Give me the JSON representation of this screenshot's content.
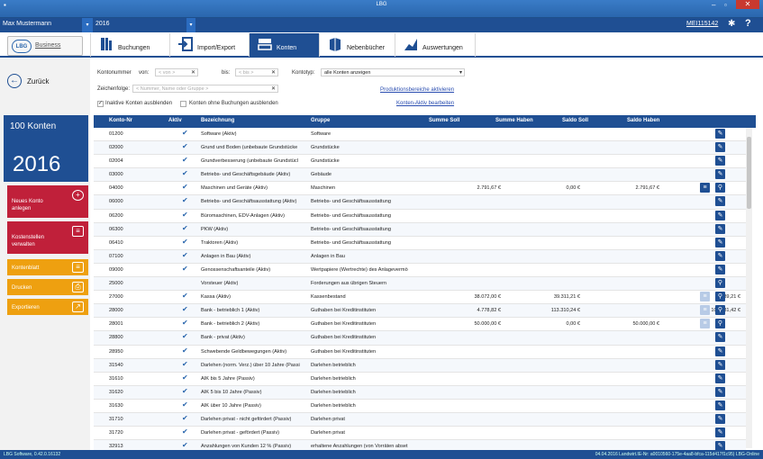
{
  "window": {
    "title": "LBG"
  },
  "userbar": {
    "user": "Max Mustermann",
    "year": "2016",
    "code": "MEI115142"
  },
  "logo": {
    "brand": "LBG",
    "link": "Business"
  },
  "nav": {
    "tabs": [
      {
        "label": "Buchungen",
        "icon": "ledger-icon"
      },
      {
        "label": "Import/Export",
        "icon": "import-export-icon"
      },
      {
        "label": "Konten",
        "icon": "accounts-icon",
        "active": true
      },
      {
        "label": "Nebenbücher",
        "icon": "books-icon"
      },
      {
        "label": "Auswertungen",
        "icon": "chart-icon"
      }
    ]
  },
  "sidebar": {
    "back_label": "Zurück",
    "count_label": "100 Konten",
    "year": "2016",
    "buttons": [
      {
        "label": "Neues Konto anlegen",
        "icon": "plus-icon"
      },
      {
        "label": "Kostenstellen verwalten",
        "icon": "list-icon"
      },
      {
        "label": "Kontenblatt",
        "icon": "list-icon"
      },
      {
        "label": "Drucken",
        "icon": "printer-icon"
      },
      {
        "label": "Exportieren",
        "icon": "export-icon"
      }
    ]
  },
  "filters": {
    "kontonummer_label": "Kontonummer",
    "von_label": "von:",
    "von_placeholder": "< von >",
    "bis_label": "bis:",
    "bis_placeholder": "< bis >",
    "kontotyp_label": "Kontotyp:",
    "kontotyp_value": "alle Konten anzeigen",
    "zeichenfolge_label": "Zeichenfolge:",
    "zeichenfolge_placeholder": "< Nummer, Name oder Gruppe >",
    "produktionsbereiche_link": "Produktionsbereiche aktivieren",
    "inaktive_label": "Inaktive Konten ausblenden",
    "inaktive_checked": true,
    "ohne_buchungen_label": "Konten ohne Buchungen ausblenden",
    "ohne_buchungen_checked": false,
    "konten_aktiv_link": "Konten-Aktiv bearbeiten"
  },
  "table": {
    "headers": [
      "Konto-Nr",
      "Aktiv",
      "Bezeichnung",
      "Gruppe",
      "Summe Soll",
      "Summe Haben",
      "Saldo Soll",
      "Saldo Haben"
    ],
    "rows": [
      {
        "nr": "01200",
        "aktiv": true,
        "bez": "Software (Aktiv)",
        "grp": "Software",
        "ss": "",
        "sh": "",
        "sa": "",
        "sb": "",
        "list": ""
      },
      {
        "nr": "02000",
        "aktiv": true,
        "bez": "Grund und Boden (unbebaute Grundstücke",
        "grp": "Grundstücke",
        "ss": "",
        "sh": "",
        "sa": "",
        "sb": "",
        "list": ""
      },
      {
        "nr": "02004",
        "aktiv": true,
        "bez": "Grundverbesserung (unbebaute Grundstücl",
        "grp": "Grundstücke",
        "ss": "",
        "sh": "",
        "sa": "",
        "sb": "",
        "list": ""
      },
      {
        "nr": "03000",
        "aktiv": true,
        "bez": "Betriebs- und Geschäftsgebäude (Aktiv)",
        "grp": "Gebäude",
        "ss": "",
        "sh": "",
        "sa": "",
        "sb": "",
        "list": ""
      },
      {
        "nr": "04000",
        "aktiv": true,
        "bez": "Maschinen und Geräte (Aktiv)",
        "grp": "Maschinen",
        "ss": "2.791,67 €",
        "sh": "0,00 €",
        "sa": "2.791,67 €",
        "sb": "",
        "list": "solid"
      },
      {
        "nr": "06000",
        "aktiv": true,
        "bez": "Betriebs- und Geschäftsausstattung (Aktiv)",
        "grp": "Betriebs- und Geschäftsausstattung",
        "ss": "",
        "sh": "",
        "sa": "",
        "sb": "",
        "list": ""
      },
      {
        "nr": "06200",
        "aktiv": true,
        "bez": "Büromaschinen, EDV-Anlagen (Aktiv)",
        "grp": "Betriebs- und Geschäftsausstattung",
        "ss": "",
        "sh": "",
        "sa": "",
        "sb": "",
        "list": ""
      },
      {
        "nr": "06300",
        "aktiv": true,
        "bez": "PKW (Aktiv)",
        "grp": "Betriebs- und Geschäftsausstattung",
        "ss": "",
        "sh": "",
        "sa": "",
        "sb": "",
        "list": ""
      },
      {
        "nr": "06410",
        "aktiv": true,
        "bez": "Traktoren (Aktiv)",
        "grp": "Betriebs- und Geschäftsausstattung",
        "ss": "",
        "sh": "",
        "sa": "",
        "sb": "",
        "list": ""
      },
      {
        "nr": "07100",
        "aktiv": true,
        "bez": "Anlagen in Bau (Aktiv)",
        "grp": "Anlagen in Bau",
        "ss": "",
        "sh": "",
        "sa": "",
        "sb": "",
        "list": ""
      },
      {
        "nr": "09000",
        "aktiv": true,
        "bez": "Genossenschaftsanteile (Aktiv)",
        "grp": "Wertpapiere (Wertrechte) des Anlagevermö",
        "ss": "",
        "sh": "",
        "sa": "",
        "sb": "",
        "list": ""
      },
      {
        "nr": "25000",
        "aktiv": false,
        "bez": "Vorsteuer (Aktiv)",
        "grp": "Forderungen aus übrigen Steuern",
        "ss": "",
        "sh": "",
        "sa": "",
        "sb": "",
        "list": ""
      },
      {
        "nr": "27000",
        "aktiv": true,
        "bez": "Kassa (Aktiv)",
        "grp": "Kassenbestand",
        "ss": "38.072,00 €",
        "sh": "39.311,21 €",
        "sa": "",
        "sb": "1.239,21 €",
        "list": "pale"
      },
      {
        "nr": "28000",
        "aktiv": true,
        "bez": "Bank - betrieblich 1 (Aktiv)",
        "grp": "Guthaben bei Kreditinstituten",
        "ss": "4.778,82 €",
        "sh": "113.310,24 €",
        "sa": "",
        "sb": "108.531,42 €",
        "list": "pale"
      },
      {
        "nr": "28001",
        "aktiv": true,
        "bez": "Bank - betrieblich 2 (Aktiv)",
        "grp": "Guthaben bei Kreditinstituten",
        "ss": "50.000,00 €",
        "sh": "0,00 €",
        "sa": "50.000,00 €",
        "sb": "",
        "list": "pale"
      },
      {
        "nr": "28800",
        "aktiv": true,
        "bez": "Bank - privat (Aktiv)",
        "grp": "Guthaben bei Kreditinstituten",
        "ss": "",
        "sh": "",
        "sa": "",
        "sb": "",
        "list": ""
      },
      {
        "nr": "28950",
        "aktiv": true,
        "bez": "Schwebende Geldbewegungen (Aktiv)",
        "grp": "Guthaben bei Kreditinstituten",
        "ss": "",
        "sh": "",
        "sa": "",
        "sb": "",
        "list": ""
      },
      {
        "nr": "31540",
        "aktiv": true,
        "bez": "Darlehen (norm. Verz.) über 10 Jahre (Passi",
        "grp": "Darlehen betrieblich",
        "ss": "",
        "sh": "",
        "sa": "",
        "sb": "",
        "list": ""
      },
      {
        "nr": "31610",
        "aktiv": true,
        "bez": "AIK bis 5 Jahre (Passiv)",
        "grp": "Darlehen betrieblich",
        "ss": "",
        "sh": "",
        "sa": "",
        "sb": "",
        "list": ""
      },
      {
        "nr": "31620",
        "aktiv": true,
        "bez": "AIK 5 bis 10 Jahre (Passiv)",
        "grp": "Darlehen betrieblich",
        "ss": "",
        "sh": "",
        "sa": "",
        "sb": "",
        "list": ""
      },
      {
        "nr": "31630",
        "aktiv": true,
        "bez": "AIK über 10 Jahre (Passiv)",
        "grp": "Darlehen betrieblich",
        "ss": "",
        "sh": "",
        "sa": "",
        "sb": "",
        "list": ""
      },
      {
        "nr": "31710",
        "aktiv": true,
        "bez": "Darlehen privat - nicht gefördert (Passiv)",
        "grp": "Darlehen privat",
        "ss": "",
        "sh": "",
        "sa": "",
        "sb": "",
        "list": ""
      },
      {
        "nr": "31720",
        "aktiv": true,
        "bez": "Darlehen privat - gefördert (Passiv)",
        "grp": "Darlehen privat",
        "ss": "",
        "sh": "",
        "sa": "",
        "sb": "",
        "list": ""
      },
      {
        "nr": "32913",
        "aktiv": true,
        "bez": "Anzahlungen von Kunden 12 % (Passiv)",
        "grp": "erhaltene Anzahlungen (von Vorräten abset",
        "ss": "",
        "sh": "",
        "sa": "",
        "sb": "",
        "list": ""
      }
    ]
  },
  "statusbar": {
    "version": "LBG Software, 0.42.0.16132",
    "right": "04.04.2016   Landwirt.IE-Nr: a0010560-175e-4aa8-bfca-115d417f1c95)   LBG-Online"
  }
}
